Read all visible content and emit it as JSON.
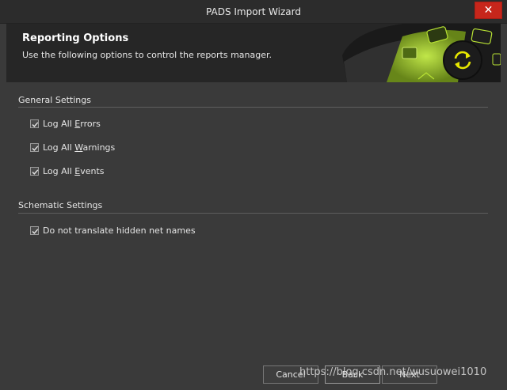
{
  "window": {
    "title": "PADS Import Wizard",
    "close_glyph": "✕"
  },
  "header": {
    "title": "Reporting Options",
    "subtitle": "Use the following options to control the reports manager.",
    "accent_color": "#b8e234"
  },
  "sections": {
    "general": {
      "title": "General Settings",
      "items": [
        {
          "pre": "Log All ",
          "mnemonic": "E",
          "post": "rrors",
          "checked": true
        },
        {
          "pre": "Log All ",
          "mnemonic": "W",
          "post": "arnings",
          "checked": true
        },
        {
          "pre": "Log All ",
          "mnemonic": "E",
          "post": "vents",
          "checked": true
        }
      ]
    },
    "schematic": {
      "title": "Schematic Settings",
      "items": [
        {
          "pre": "Do not translate hidden net names",
          "mnemonic": "",
          "post": "",
          "checked": true
        }
      ]
    }
  },
  "footer": {
    "cancel_label": "Cancel",
    "back_label": "Back",
    "next_label": "Next"
  },
  "watermark": "https://blog.csdn.net/wusuowei1010"
}
